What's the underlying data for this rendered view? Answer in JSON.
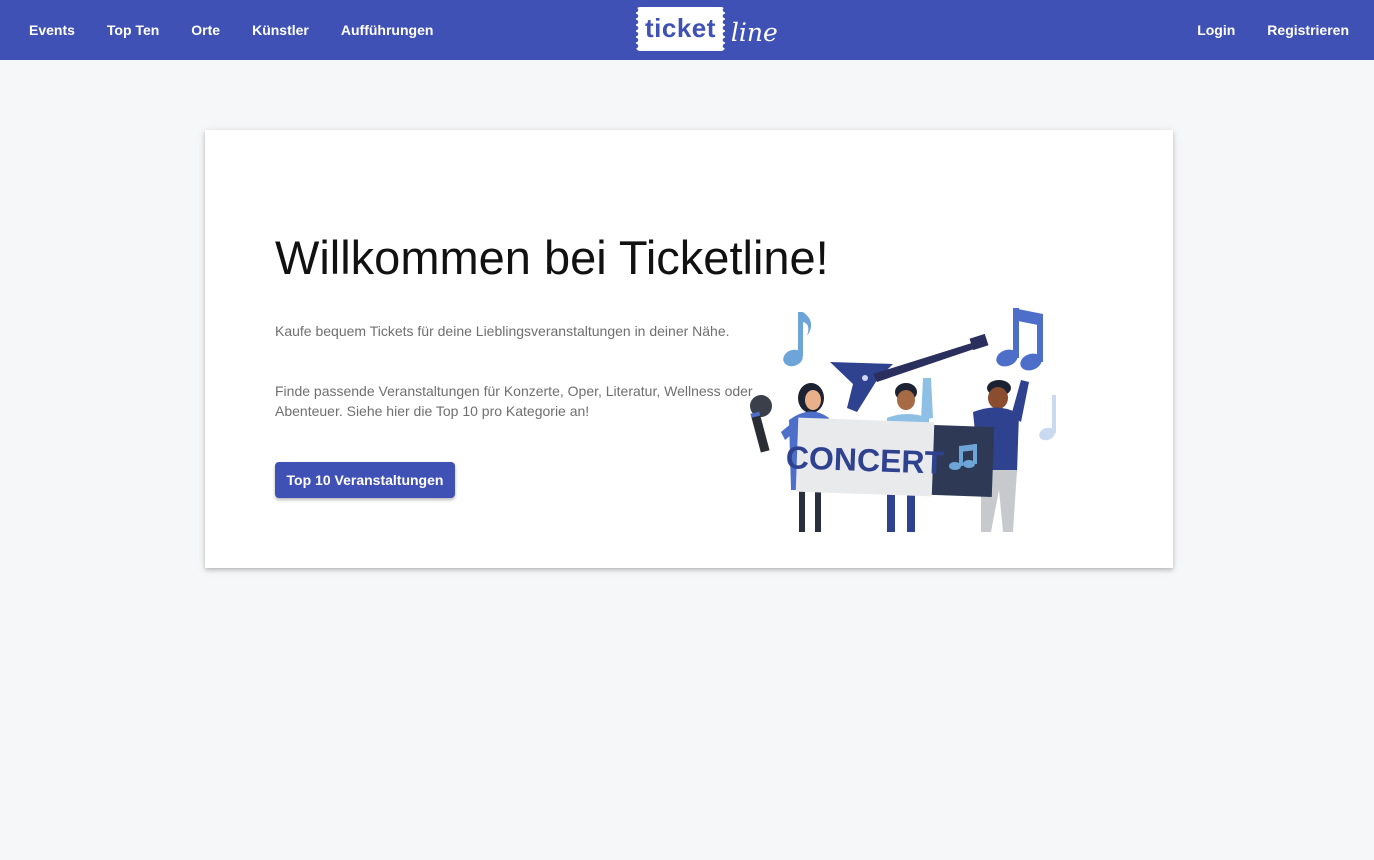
{
  "nav": {
    "left": [
      "Events",
      "Top Ten",
      "Orte",
      "Künstler",
      "Aufführungen"
    ],
    "right": [
      "Login",
      "Registrieren"
    ]
  },
  "brand": {
    "ticket": "ticket",
    "line": "line"
  },
  "hero": {
    "title": "Willkommen bei Ticketline!",
    "text1": "Kaufe bequem Tickets für deine Lieblingsveranstaltungen in deiner Nähe.",
    "text2": "Finde passende Veranstaltungen für Konzerte, Oper, Literatur, Wellness oder Abenteuer. Siehe hier die Top 10 pro Kategorie an!",
    "button": "Top 10 Veranstaltungen"
  },
  "illustration": {
    "banner_text": "CONCERT",
    "icon": "music-note-icon"
  },
  "colors": {
    "primary": "#3f51b5",
    "background": "#f6f7f9",
    "card": "#ffffff"
  }
}
